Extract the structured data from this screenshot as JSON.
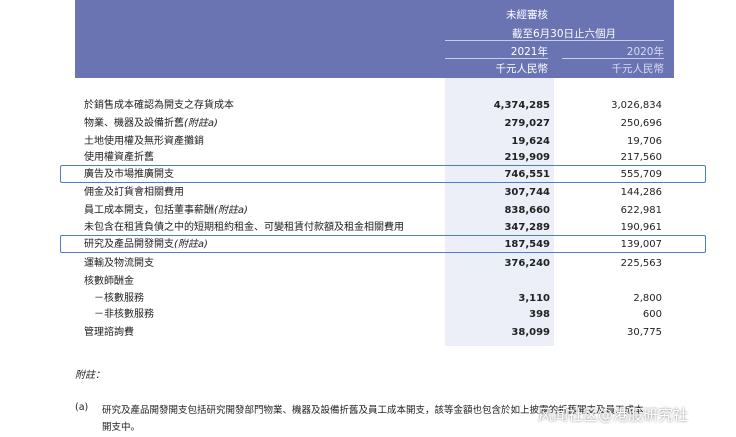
{
  "header": {
    "unaudited": "未經審核",
    "period": "截至6月30日止六個月",
    "year_2021": "2021年",
    "year_2020": "2020年",
    "unit_2021": "千元人民幣",
    "unit_2020": "千元人民幣"
  },
  "rows": [
    {
      "label": "於銷售成本確認為開支之存貨成本",
      "note": "",
      "v2021": "4,374,285",
      "v2020": "3,026,834"
    },
    {
      "label": "物業、機器及設備折舊",
      "note": "(附註a)",
      "v2021": "279,027",
      "v2020": "250,696"
    },
    {
      "label": "土地使用權及無形資產攤銷",
      "note": "",
      "v2021": "19,624",
      "v2020": "19,706"
    },
    {
      "label": "使用權資產折舊",
      "note": "",
      "v2021": "219,909",
      "v2020": "217,560"
    },
    {
      "label": "廣告及市場推廣開支",
      "note": "",
      "v2021": "746,551",
      "v2020": "555,709"
    },
    {
      "label": "佣金及訂貨會相關費用",
      "note": "",
      "v2021": "307,744",
      "v2020": "144,286"
    },
    {
      "label": "員工成本開支，包括董事薪酬",
      "note": "(附註a)",
      "v2021": "838,660",
      "v2020": "622,981"
    },
    {
      "label": "未包含在租賃負債之中的短期租約租金、可變租賃付款額及租金相關費用",
      "note": "",
      "v2021": "347,289",
      "v2020": "190,961"
    },
    {
      "label": "研究及產品開發開支",
      "note": "(附註a)",
      "v2021": "187,549",
      "v2020": "139,007"
    },
    {
      "label": "運輸及物流開支",
      "note": "",
      "v2021": "376,240",
      "v2020": "225,563"
    },
    {
      "label": "核數師酬金",
      "note": "",
      "v2021": "",
      "v2020": ""
    },
    {
      "label": "－核數服務",
      "note": "",
      "v2021": "3,110",
      "v2020": "2,800"
    },
    {
      "label": "－非核數服務",
      "note": "",
      "v2021": "398",
      "v2020": "600"
    },
    {
      "label": "管理諮詢費",
      "note": "",
      "v2021": "38,099",
      "v2020": "30,775"
    }
  ],
  "footnote": {
    "title": "附註：",
    "mark": "(a)",
    "line1": "研究及產品開發開支包括研究開發部門物業、機器及設備折舊及員工成本開支，該等金額也包含於如上披露的折舊開支及員工成本",
    "line2": "開支中。"
  },
  "watermark": "风闻社区@港股研究社",
  "colors": {
    "header_bg": "#6b74b3",
    "highlight_border": "#4a7fc9",
    "column_shade": "#eceef8"
  }
}
